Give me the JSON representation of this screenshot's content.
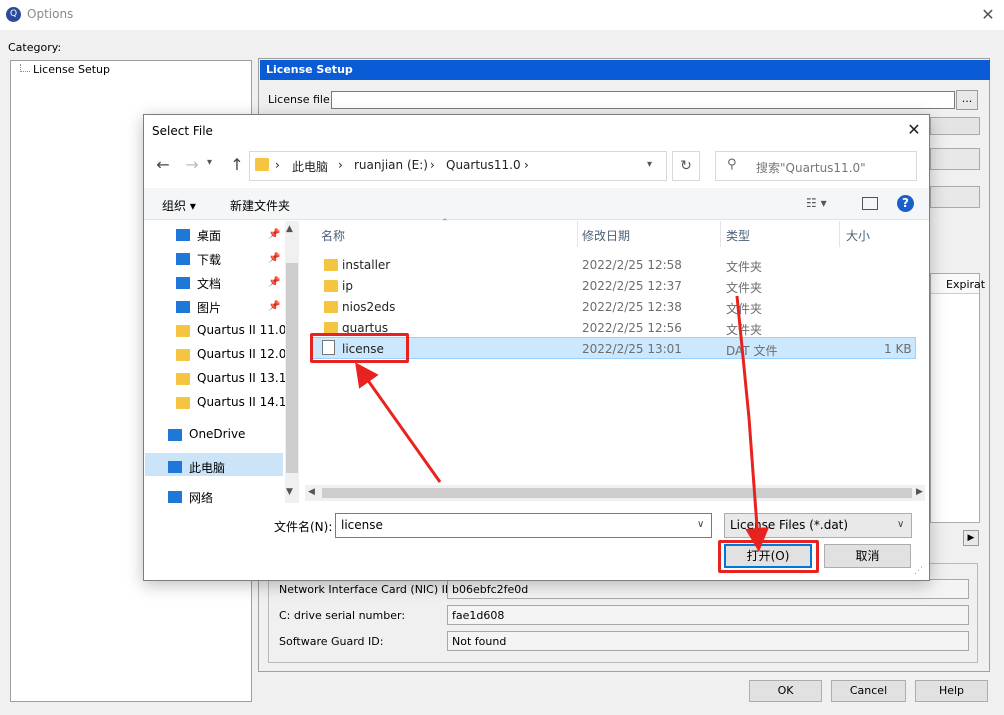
{
  "options_window": {
    "title": "Options",
    "app_icon_glyph": "Q",
    "close_glyph": "✕",
    "category_label": "Category:",
    "tree_item": "License Setup",
    "panel_header": "License Setup",
    "license_file_label": "License file:",
    "license_file_value": "",
    "browse_label": "...",
    "table_header_fragment": "Expirat",
    "nic_label": "Network Interface Card (NIC) ID:",
    "nic_value": "b06ebfc2fe0d",
    "cdrive_label": "C: drive serial number:",
    "cdrive_value": "fae1d608",
    "guard_label": "Software Guard ID:",
    "guard_value": "Not found",
    "ok_label": "OK",
    "cancel_label": "Cancel",
    "help_label": "Help"
  },
  "select_file": {
    "title": "Select File",
    "close_glyph": "✕",
    "breadcrumb": [
      "此电脑",
      "ruanjian (E:)",
      "Quartus11.0"
    ],
    "search_placeholder": "搜索\"Quartus11.0\"",
    "toolbar": {
      "organize": "组织 ▾",
      "new_folder": "新建文件夹"
    },
    "nav_items": [
      {
        "label": "桌面",
        "icon": "desktop-icon",
        "pinned": true
      },
      {
        "label": "下载",
        "icon": "download-icon",
        "pinned": true
      },
      {
        "label": "文档",
        "icon": "document-icon",
        "pinned": true
      },
      {
        "label": "图片",
        "icon": "picture-icon",
        "pinned": true
      },
      {
        "label": "Quartus II 11.0",
        "icon": "folder-icon",
        "pinned": false
      },
      {
        "label": "Quartus II 12.0",
        "icon": "folder-icon",
        "pinned": false
      },
      {
        "label": "Quartus II 13.1",
        "icon": "folder-icon",
        "pinned": false
      },
      {
        "label": "Quartus II 14.1",
        "icon": "folder-icon",
        "pinned": false
      },
      {
        "label": "OneDrive",
        "icon": "cloud-icon",
        "pinned": false
      },
      {
        "label": "此电脑",
        "icon": "computer-icon",
        "pinned": false,
        "selected": true
      },
      {
        "label": "网络",
        "icon": "network-icon",
        "pinned": false
      }
    ],
    "columns": [
      "名称",
      "修改日期",
      "类型",
      "大小"
    ],
    "files": [
      {
        "name": "installer",
        "date": "2022/2/25 12:58",
        "type": "文件夹",
        "size": ""
      },
      {
        "name": "ip",
        "date": "2022/2/25 12:37",
        "type": "文件夹",
        "size": ""
      },
      {
        "name": "nios2eds",
        "date": "2022/2/25 12:38",
        "type": "文件夹",
        "size": ""
      },
      {
        "name": "quartus",
        "date": "2022/2/25 12:56",
        "type": "文件夹",
        "size": ""
      },
      {
        "name": "license",
        "date": "2022/2/25 13:01",
        "type": "DAT 文件",
        "size": "1 KB",
        "selected": true
      }
    ],
    "filename_label": "文件名(N):",
    "filename_value": "license",
    "filter_value": "License Files (*.dat)",
    "open_label": "打开(O)",
    "cancel_label": "取消"
  },
  "colors": {
    "accent": "#0a5bd6",
    "annotation": "#e8231f",
    "selection": "#cce8ff"
  }
}
